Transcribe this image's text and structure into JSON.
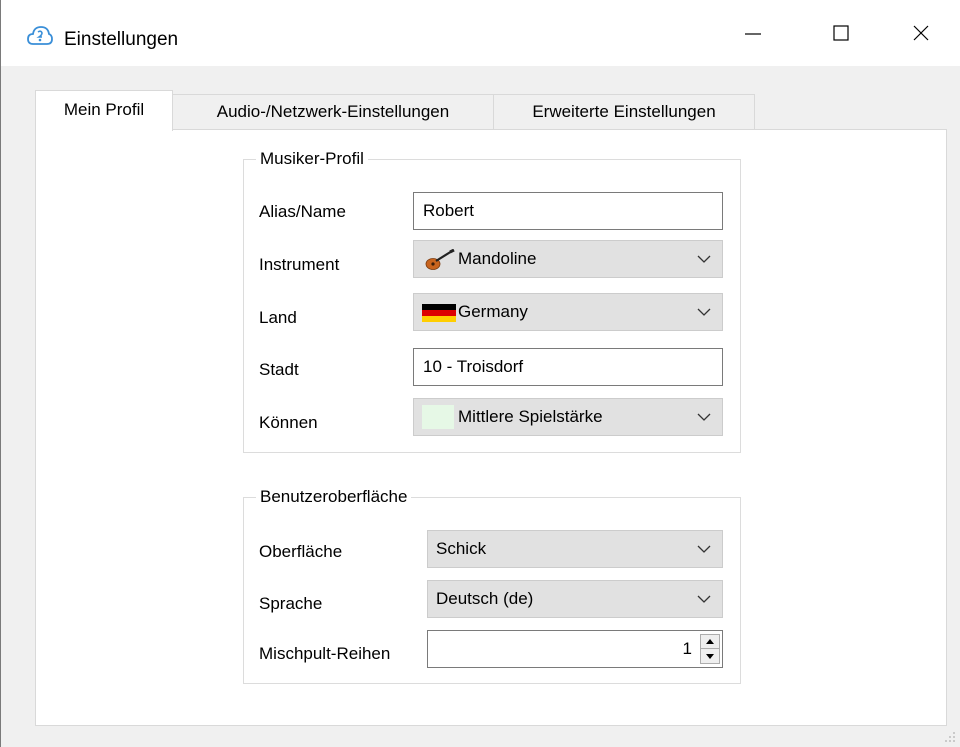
{
  "window": {
    "title": "Einstellungen",
    "minimize_icon": "minimize-icon",
    "maximize_icon": "maximize-icon",
    "close_icon": "close-icon"
  },
  "tabs": [
    {
      "label": "Mein Profil",
      "active": true
    },
    {
      "label": "Audio-/Netzwerk-Einstellungen",
      "active": false
    },
    {
      "label": "Erweiterte Einstellungen",
      "active": false
    }
  ],
  "profile": {
    "group_title": "Musiker-Profil",
    "alias_label": "Alias/Name",
    "alias_value": "Robert",
    "instrument_label": "Instrument",
    "instrument_value": "Mandoline",
    "instrument_icon": "mandolin-icon",
    "country_label": "Land",
    "country_value": "Germany",
    "country_icon": "germany-flag-icon",
    "city_label": "Stadt",
    "city_value": "10 - Troisdorf",
    "skill_label": "Können",
    "skill_value": "Mittlere Spielstärke",
    "skill_color": "#e6f8e6"
  },
  "ui": {
    "group_title": "Benutzeroberfläche",
    "skin_label": "Oberfläche",
    "skin_value": "Schick",
    "language_label": "Sprache",
    "language_value": "Deutsch (de)",
    "mixer_rows_label": "Mischpult-Reihen",
    "mixer_rows_value": "1"
  }
}
